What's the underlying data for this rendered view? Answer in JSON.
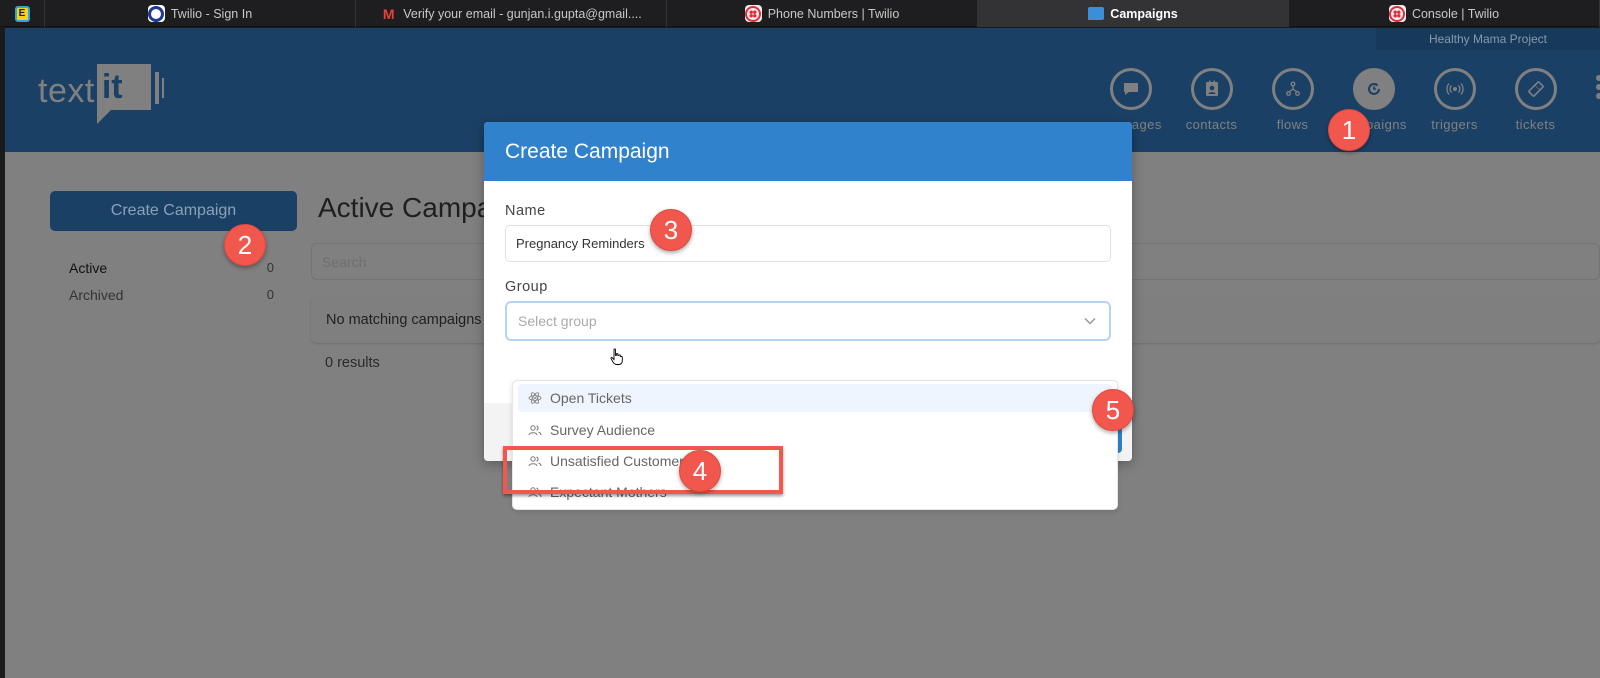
{
  "browser": {
    "tabs": [
      {
        "label": "Twilio - Sign In",
        "icon": "twilio-circle-icon",
        "active": false
      },
      {
        "label": "Verify your email - gunjan.i.gupta@gmail....",
        "icon": "gmail-icon",
        "active": false
      },
      {
        "label": "Phone Numbers | Twilio",
        "icon": "twilio-icon",
        "active": false
      },
      {
        "label": "Campaigns",
        "icon": "chat-bubble-icon",
        "active": true
      },
      {
        "label": "Console | Twilio",
        "icon": "twilio-icon",
        "active": false
      }
    ],
    "extension_label": "E"
  },
  "header": {
    "org_name": "Healthy Mama Project",
    "logo_text": "text",
    "logo_box_text": "it",
    "nav": [
      {
        "label": "messages",
        "icon": "message-icon",
        "active": false
      },
      {
        "label": "contacts",
        "icon": "contact-card-icon",
        "active": false
      },
      {
        "label": "flows",
        "icon": "flow-tree-icon",
        "active": false
      },
      {
        "label": "campaigns",
        "icon": "campaign-clock-icon",
        "active": true
      },
      {
        "label": "triggers",
        "icon": "broadcast-icon",
        "active": false
      },
      {
        "label": "tickets",
        "icon": "ticket-icon",
        "active": false
      }
    ]
  },
  "sidebar": {
    "create_button": "Create Campaign",
    "items": [
      {
        "label": "Active",
        "count": "0"
      },
      {
        "label": "Archived",
        "count": "0"
      }
    ]
  },
  "main": {
    "title": "Active Campaigns",
    "search_placeholder": "Search",
    "empty_message": "No matching campaigns",
    "results": "0 results"
  },
  "modal": {
    "title": "Create Campaign",
    "name_label": "Name",
    "name_value": "Pregnancy Reminders",
    "group_label": "Group",
    "group_placeholder": "Select group",
    "options": [
      {
        "label": "Open Tickets",
        "icon": "atom-icon",
        "highlighted": true
      },
      {
        "label": "Survey Audience",
        "icon": "users-icon",
        "highlighted": false
      },
      {
        "label": "Unsatisfied Customers",
        "icon": "users-icon",
        "highlighted": false
      },
      {
        "label": "Expectant Mothers",
        "icon": "users-icon",
        "highlighted": false
      }
    ]
  },
  "annotations": {
    "badges": [
      "1",
      "2",
      "3",
      "4",
      "5"
    ],
    "color": "#f2574d"
  },
  "colors": {
    "header_bg": "#1a4165",
    "modal_header": "#2f82cb",
    "overlay": "#808080"
  }
}
